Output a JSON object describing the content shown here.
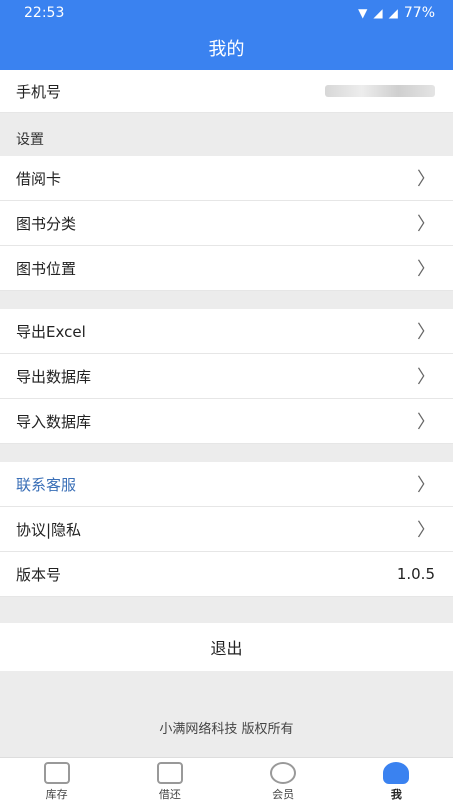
{
  "status_bar": {
    "time": "22:53",
    "battery": "77%"
  },
  "header": {
    "title": "我的"
  },
  "phone": {
    "label": "手机号"
  },
  "settings": {
    "title": "设置",
    "items": [
      {
        "label": "借阅卡"
      },
      {
        "label": "图书分类"
      },
      {
        "label": "图书位置"
      }
    ]
  },
  "data_group": {
    "items": [
      {
        "label": "导出Excel"
      },
      {
        "label": "导出数据库"
      },
      {
        "label": "导入数据库"
      }
    ]
  },
  "about": {
    "contact": "联系客服",
    "privacy": "协议|隐私",
    "version_label": "版本号",
    "version_value": "1.0.5"
  },
  "logout_label": "退出",
  "copyright": "小满网络科技 版权所有",
  "tabs": [
    {
      "label": "库存"
    },
    {
      "label": "借还"
    },
    {
      "label": "会员"
    },
    {
      "label": "我"
    }
  ]
}
